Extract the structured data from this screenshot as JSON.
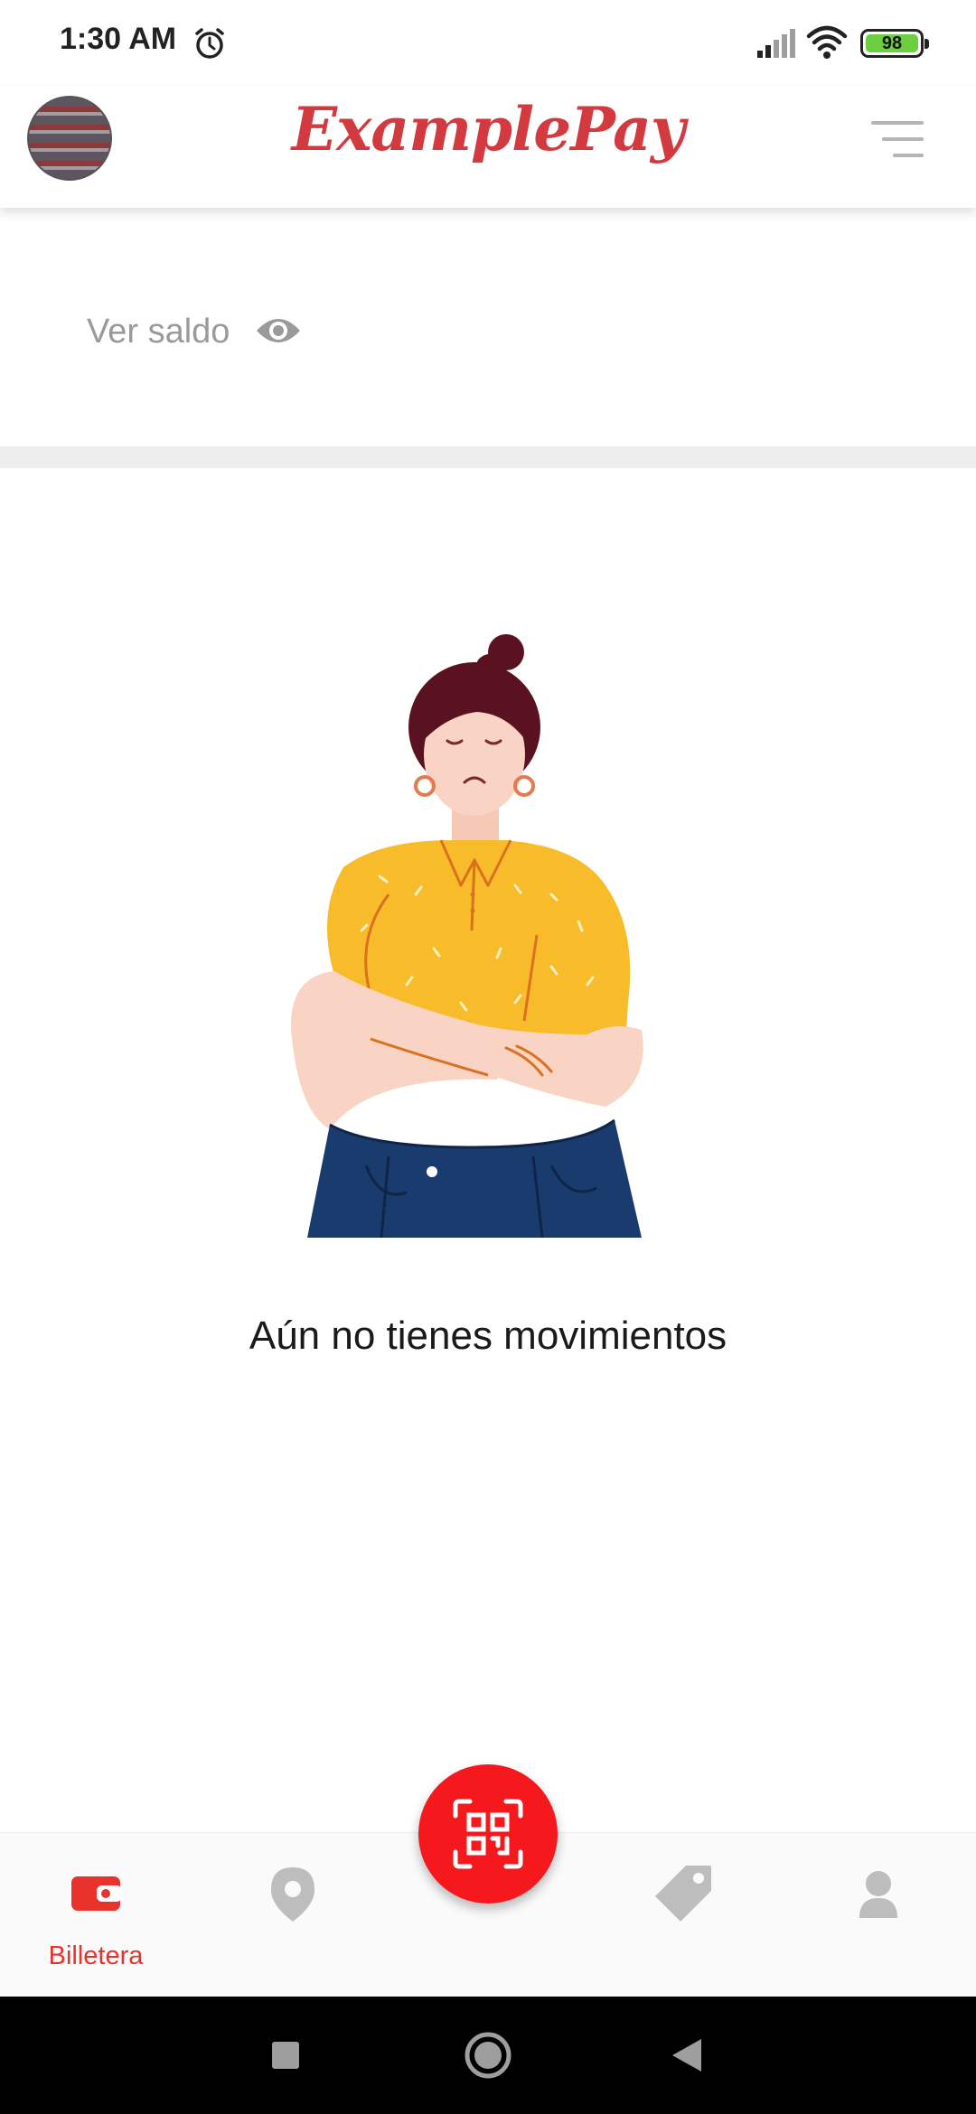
{
  "status_bar": {
    "time": "1:30 AM",
    "battery_level": "98",
    "icons": [
      "alarm-icon",
      "signal-icon",
      "wifi-icon",
      "battery-icon"
    ]
  },
  "header": {
    "brand": "ExamplePay",
    "avatar": "avatar-photo",
    "menu": "menu-icon"
  },
  "balance": {
    "label": "Ver saldo",
    "icon": "eye-icon"
  },
  "empty_state": {
    "message": "Aún no tienes movimientos",
    "illustration": "woman-arms-crossed-illustration"
  },
  "bottom_nav": {
    "items": [
      {
        "label": "Billetera",
        "icon": "wallet-icon",
        "active": true
      },
      {
        "label": "",
        "icon": "location-pin-icon",
        "active": false
      },
      {
        "label": "",
        "icon": "tag-icon",
        "active": false
      },
      {
        "label": "",
        "icon": "user-icon",
        "active": false
      }
    ],
    "fab_icon": "qr-scan-icon"
  },
  "system_nav": {
    "buttons": [
      "recents-button",
      "home-button",
      "back-button"
    ]
  },
  "colors": {
    "brand": "#d23a3f",
    "accent": "#f5181d",
    "inactive": "#bdbdbd",
    "label_gray": "#9a9a9a"
  }
}
